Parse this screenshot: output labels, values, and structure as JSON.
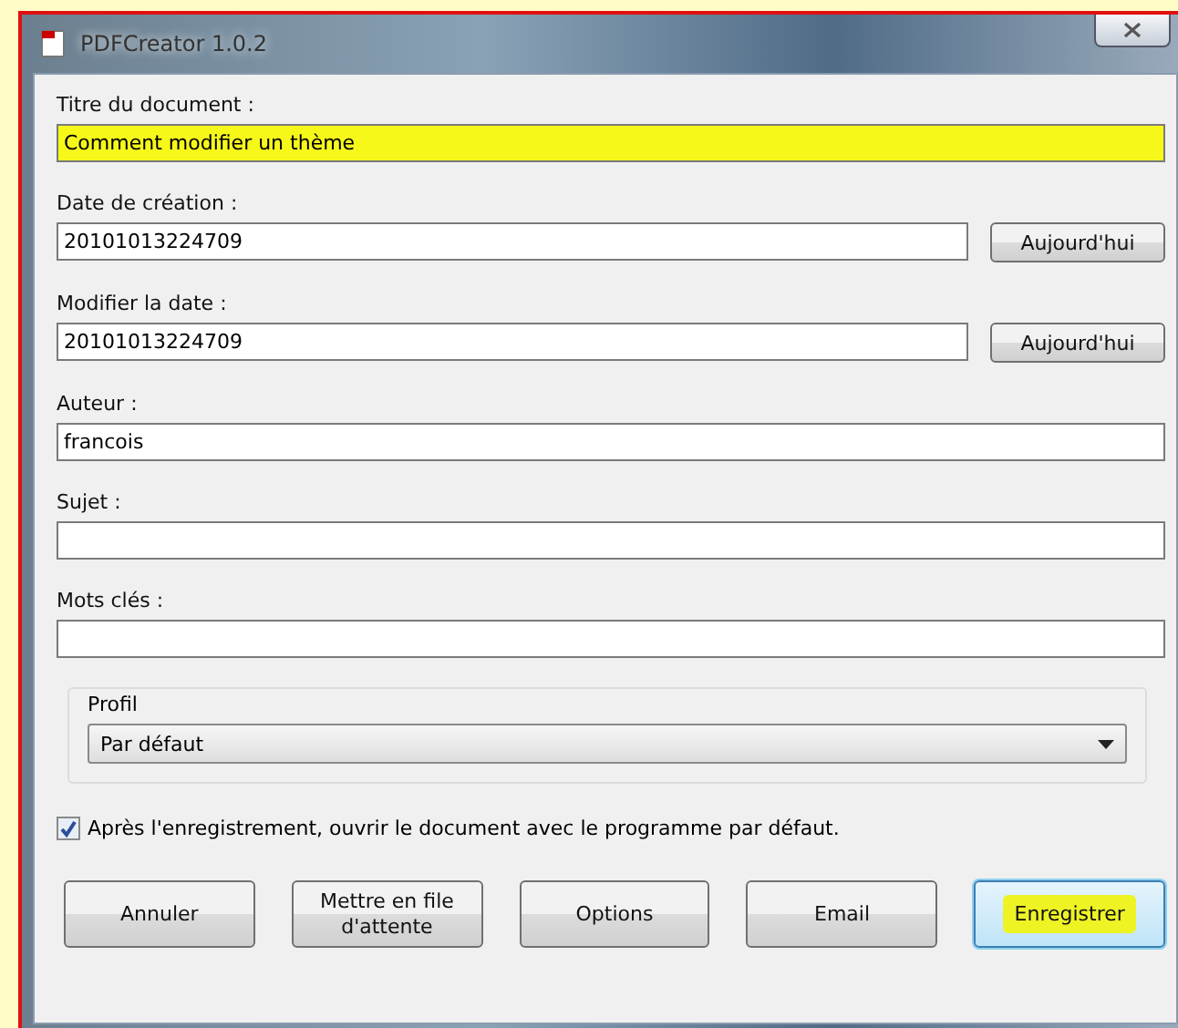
{
  "window": {
    "title": "PDFCreator 1.0.2"
  },
  "fields": [
    {
      "label": "Titre du document :",
      "value": "Comment modifier un thème",
      "highlighted": true
    },
    {
      "label": "Date de création :",
      "value": "20101013224709",
      "button": "Aujourd'hui",
      "highlighted": false
    },
    {
      "label": "Modifier la date :",
      "value": "20101013224709",
      "button": "Aujourd'hui",
      "highlighted": false
    },
    {
      "label": "Auteur :",
      "value": "francois",
      "highlighted": false
    },
    {
      "label": "Sujet :",
      "highlighted": false
    },
    {
      "label": "Mots clés :",
      "highlighted": false
    }
  ],
  "profile": {
    "label": "Profil",
    "value": "Par défaut"
  },
  "open_after_save": {
    "label": "Après l'enregistrement, ouvrir le document avec le programme par défaut.",
    "checked": true
  },
  "buttons": [
    {
      "label": "Annuler",
      "highlighted": false
    },
    {
      "label": "Mettre en file d'attente",
      "highlighted": false
    },
    {
      "label": "Options",
      "highlighted": false
    },
    {
      "label": "Email",
      "highlighted": false
    },
    {
      "label": "Enregistrer",
      "highlighted": true
    }
  ]
}
